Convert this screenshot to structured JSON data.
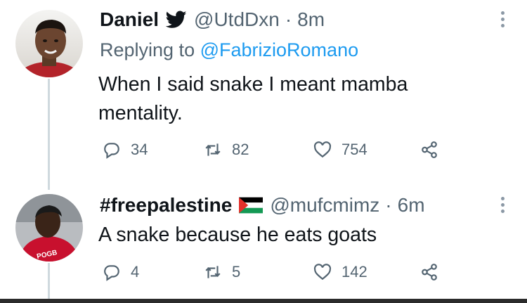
{
  "tweets": [
    {
      "display_name": "Daniel",
      "handle": "@UtdDxn",
      "separator": "·",
      "time": "8m",
      "replying_prefix": "Replying to",
      "replying_to": "@FabrizioRomano",
      "text_line1": "When I said snake I meant mamba",
      "text_line2": "mentality.",
      "replies": "34",
      "retweets": "82",
      "likes": "754"
    },
    {
      "display_name": "#freepalestine",
      "handle": "@mufcmimz",
      "separator": "·",
      "time": "6m",
      "text_line1": "A snake because he eats goats",
      "replies": "4",
      "retweets": "5",
      "likes": "142",
      "avatar_jersey_text": "POGB"
    }
  ],
  "colors": {
    "link": "#1d9bf0",
    "muted": "#536471",
    "text": "#0f1419",
    "thread_line": "#cfd9de"
  },
  "icons": [
    "verified-twitter-bird-icon",
    "palestine-flag-icon",
    "reply-icon",
    "retweet-icon",
    "like-icon",
    "share-icon",
    "more-icon"
  ]
}
